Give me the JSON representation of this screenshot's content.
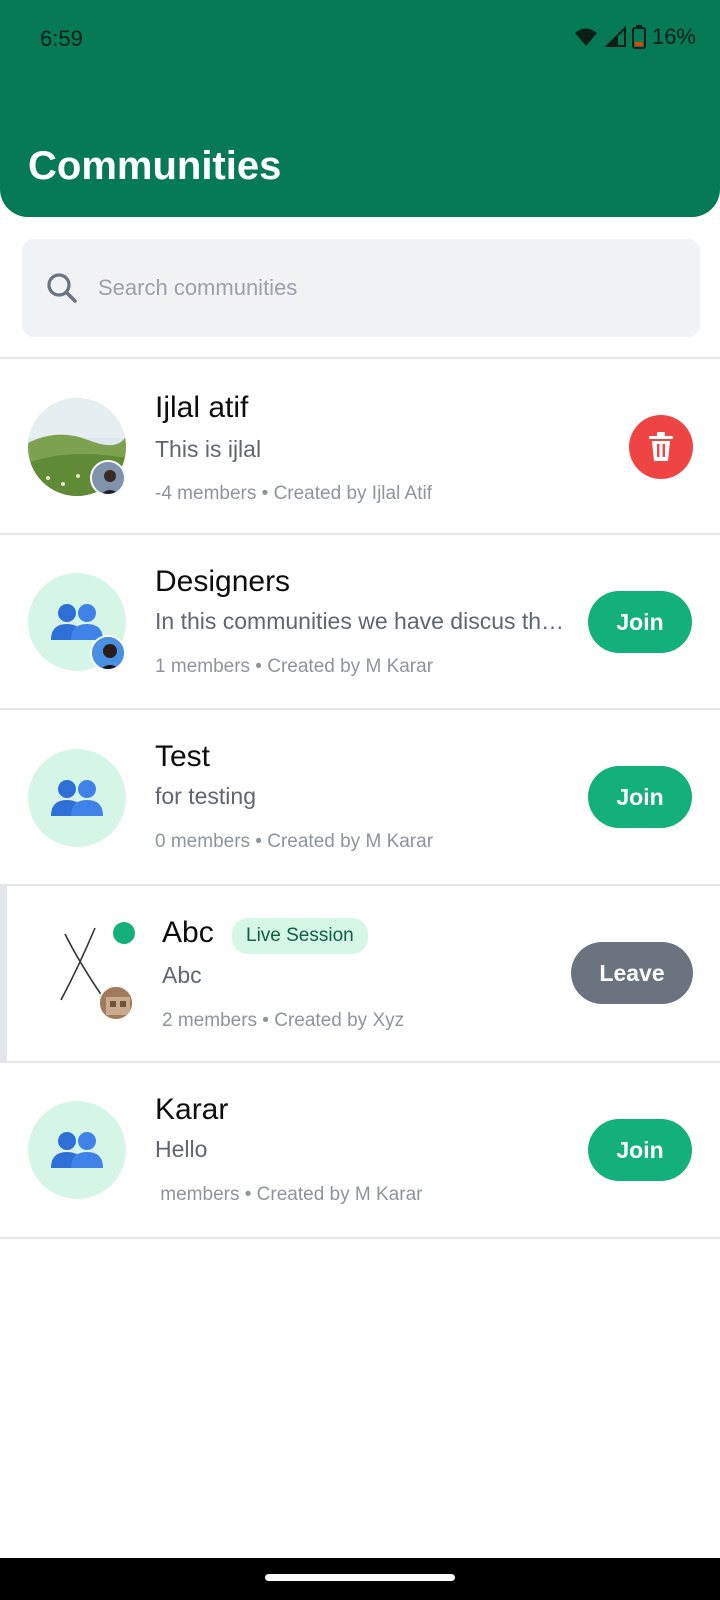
{
  "status_bar": {
    "time": "6:59",
    "battery": "16%"
  },
  "header": {
    "title": "Communities"
  },
  "search": {
    "placeholder": "Search communities"
  },
  "communities": [
    {
      "name": "Ijlal atif",
      "description": "This is ijlal",
      "meta": "-4 members • Created by Ijlal Atif",
      "action": "delete",
      "avatar": "photo"
    },
    {
      "name": "Designers",
      "description": "In this communities we have discus th…",
      "meta": "1 members • Created by M Karar",
      "action": "Join",
      "avatar": "users-icon"
    },
    {
      "name": "Test",
      "description": "for testing",
      "meta": "0 members • Created by M Karar",
      "action": "Join",
      "avatar": "users-icon"
    },
    {
      "name": "Abc",
      "badge": "Live Session",
      "description": "Abc",
      "meta": "2 members • Created by Xyz",
      "action": "Leave",
      "avatar": "sketch"
    },
    {
      "name": "Karar",
      "description": "Hello",
      "meta": " members • Created by M Karar",
      "action": "Join",
      "avatar": "users-icon"
    }
  ],
  "colors": {
    "header": "#067a55",
    "join": "#13b07c",
    "leave": "#6b7280",
    "delete": "#ef4444",
    "badge_bg": "#d6f6e6"
  }
}
